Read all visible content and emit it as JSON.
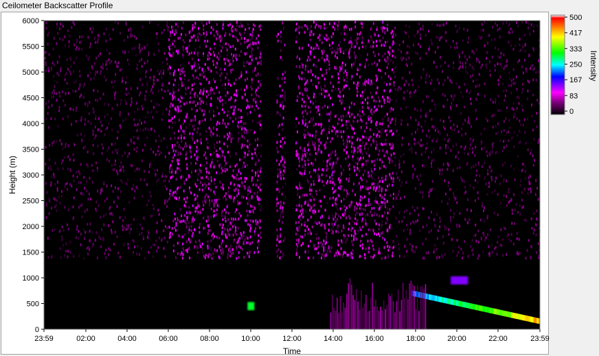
{
  "window": {
    "title": "Ceilometer Backscatter Profile"
  },
  "chart_data": {
    "type": "heatmap",
    "title": "Ceilometer Backscatter Profile",
    "xlabel": "Time",
    "ylabel": "Height (m)",
    "x_ticks": [
      "23:59",
      "02:00",
      "04:00",
      "06:00",
      "08:00",
      "10:00",
      "12:00",
      "14:00",
      "16:00",
      "18:00",
      "20:00",
      "22:00",
      "23:59"
    ],
    "y_ticks": [
      0,
      500,
      1000,
      1500,
      2000,
      2500,
      3000,
      3500,
      4000,
      4500,
      5000,
      5500,
      6000
    ],
    "ylim": [
      0,
      6000
    ],
    "colorbar": {
      "label": "Intensity",
      "ticks": [
        0,
        83,
        167,
        250,
        333,
        417,
        500
      ],
      "range": [
        0,
        500
      ],
      "colors": [
        "#000000",
        "#b000b0",
        "#ff00ff",
        "#0000ff",
        "#00ffff",
        "#00ff00",
        "#ffff00",
        "#ff6000",
        "#ff0000",
        "#ffffff"
      ]
    },
    "grid": false,
    "features": [
      {
        "name": "data-gap",
        "start": "10:30",
        "end": "11:10"
      },
      {
        "name": "data-gap",
        "start": "11:40",
        "end": "12:05"
      },
      {
        "name": "cloud-layer",
        "start": "17:45",
        "end": "23:59",
        "height_start_m": 700,
        "height_end_m": 150,
        "peak_intensity": 450
      },
      {
        "name": "elevated-layer",
        "start": "19:40",
        "end": "20:30",
        "height_m": 950,
        "peak_intensity": 150
      },
      {
        "name": "aerosol-plume",
        "start": "13:50",
        "end": "18:30",
        "height_top_m": 1000,
        "peak_intensity": 120
      },
      {
        "name": "small-cloud",
        "start": "09:50",
        "end": "10:10",
        "height_m": 450,
        "peak_intensity": 300
      }
    ]
  }
}
